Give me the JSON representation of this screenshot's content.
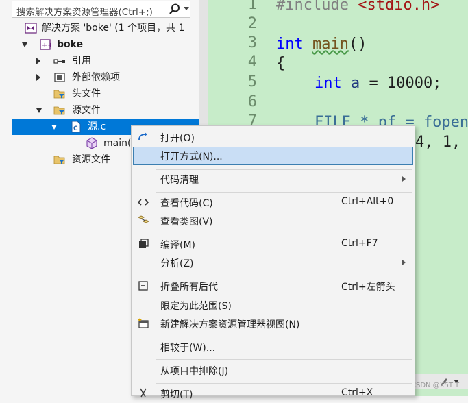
{
  "search": {
    "placeholder": "搜索解决方案资源管理器(Ctrl+;)"
  },
  "tree": {
    "solution": "解决方案 'boke' (1 个项目，共 1",
    "project": "boke",
    "references": "引用",
    "external_deps": "外部依赖项",
    "header_files": "头文件",
    "source_files": "源文件",
    "source_file": "源.c",
    "main_fn": "main(",
    "resource_files": "资源文件"
  },
  "code": {
    "line_numbers": [
      "1",
      "2",
      "3",
      "4",
      "5",
      "6",
      "7"
    ],
    "l1_pp": "#include ",
    "l1_str": "<stdio.h>",
    "l3_kw": "int",
    "l3_fn": "main",
    "l3_rest": "()",
    "l4": "{",
    "l5_kw": "int",
    "l5_var": "a",
    "l5_rest": " = 10000;",
    "l7_partial": "FILE * pf = fopen",
    "l8_partial": "4, 1,"
  },
  "menu": {
    "open": "打开(O)",
    "open_with": "打开方式(N)...",
    "code_cleanup": "代码清理",
    "view_code": "查看代码(C)",
    "view_code_sc": "Ctrl+Alt+0",
    "view_class_diagram": "查看类图(V)",
    "compile": "编译(M)",
    "compile_sc": "Ctrl+F7",
    "analyze": "分析(Z)",
    "collapse_all": "折叠所有后代",
    "collapse_all_sc": "Ctrl+左箭头",
    "scope_to_this": "限定为此范围(S)",
    "new_view": "新建解决方案资源管理器视图(N)",
    "compare_with": "相较于(W)...",
    "exclude": "从项目中排除(J)",
    "cut": "剪切(T)",
    "cut_sc": "Ctrl+X"
  },
  "watermark": "CSDN @X5TIT",
  "colors": {
    "editor_bg": "#c7ecc9",
    "selection": "#0078d7",
    "keyword": "#0000ff",
    "string": "#a31515",
    "highlight": "#c9def5"
  }
}
